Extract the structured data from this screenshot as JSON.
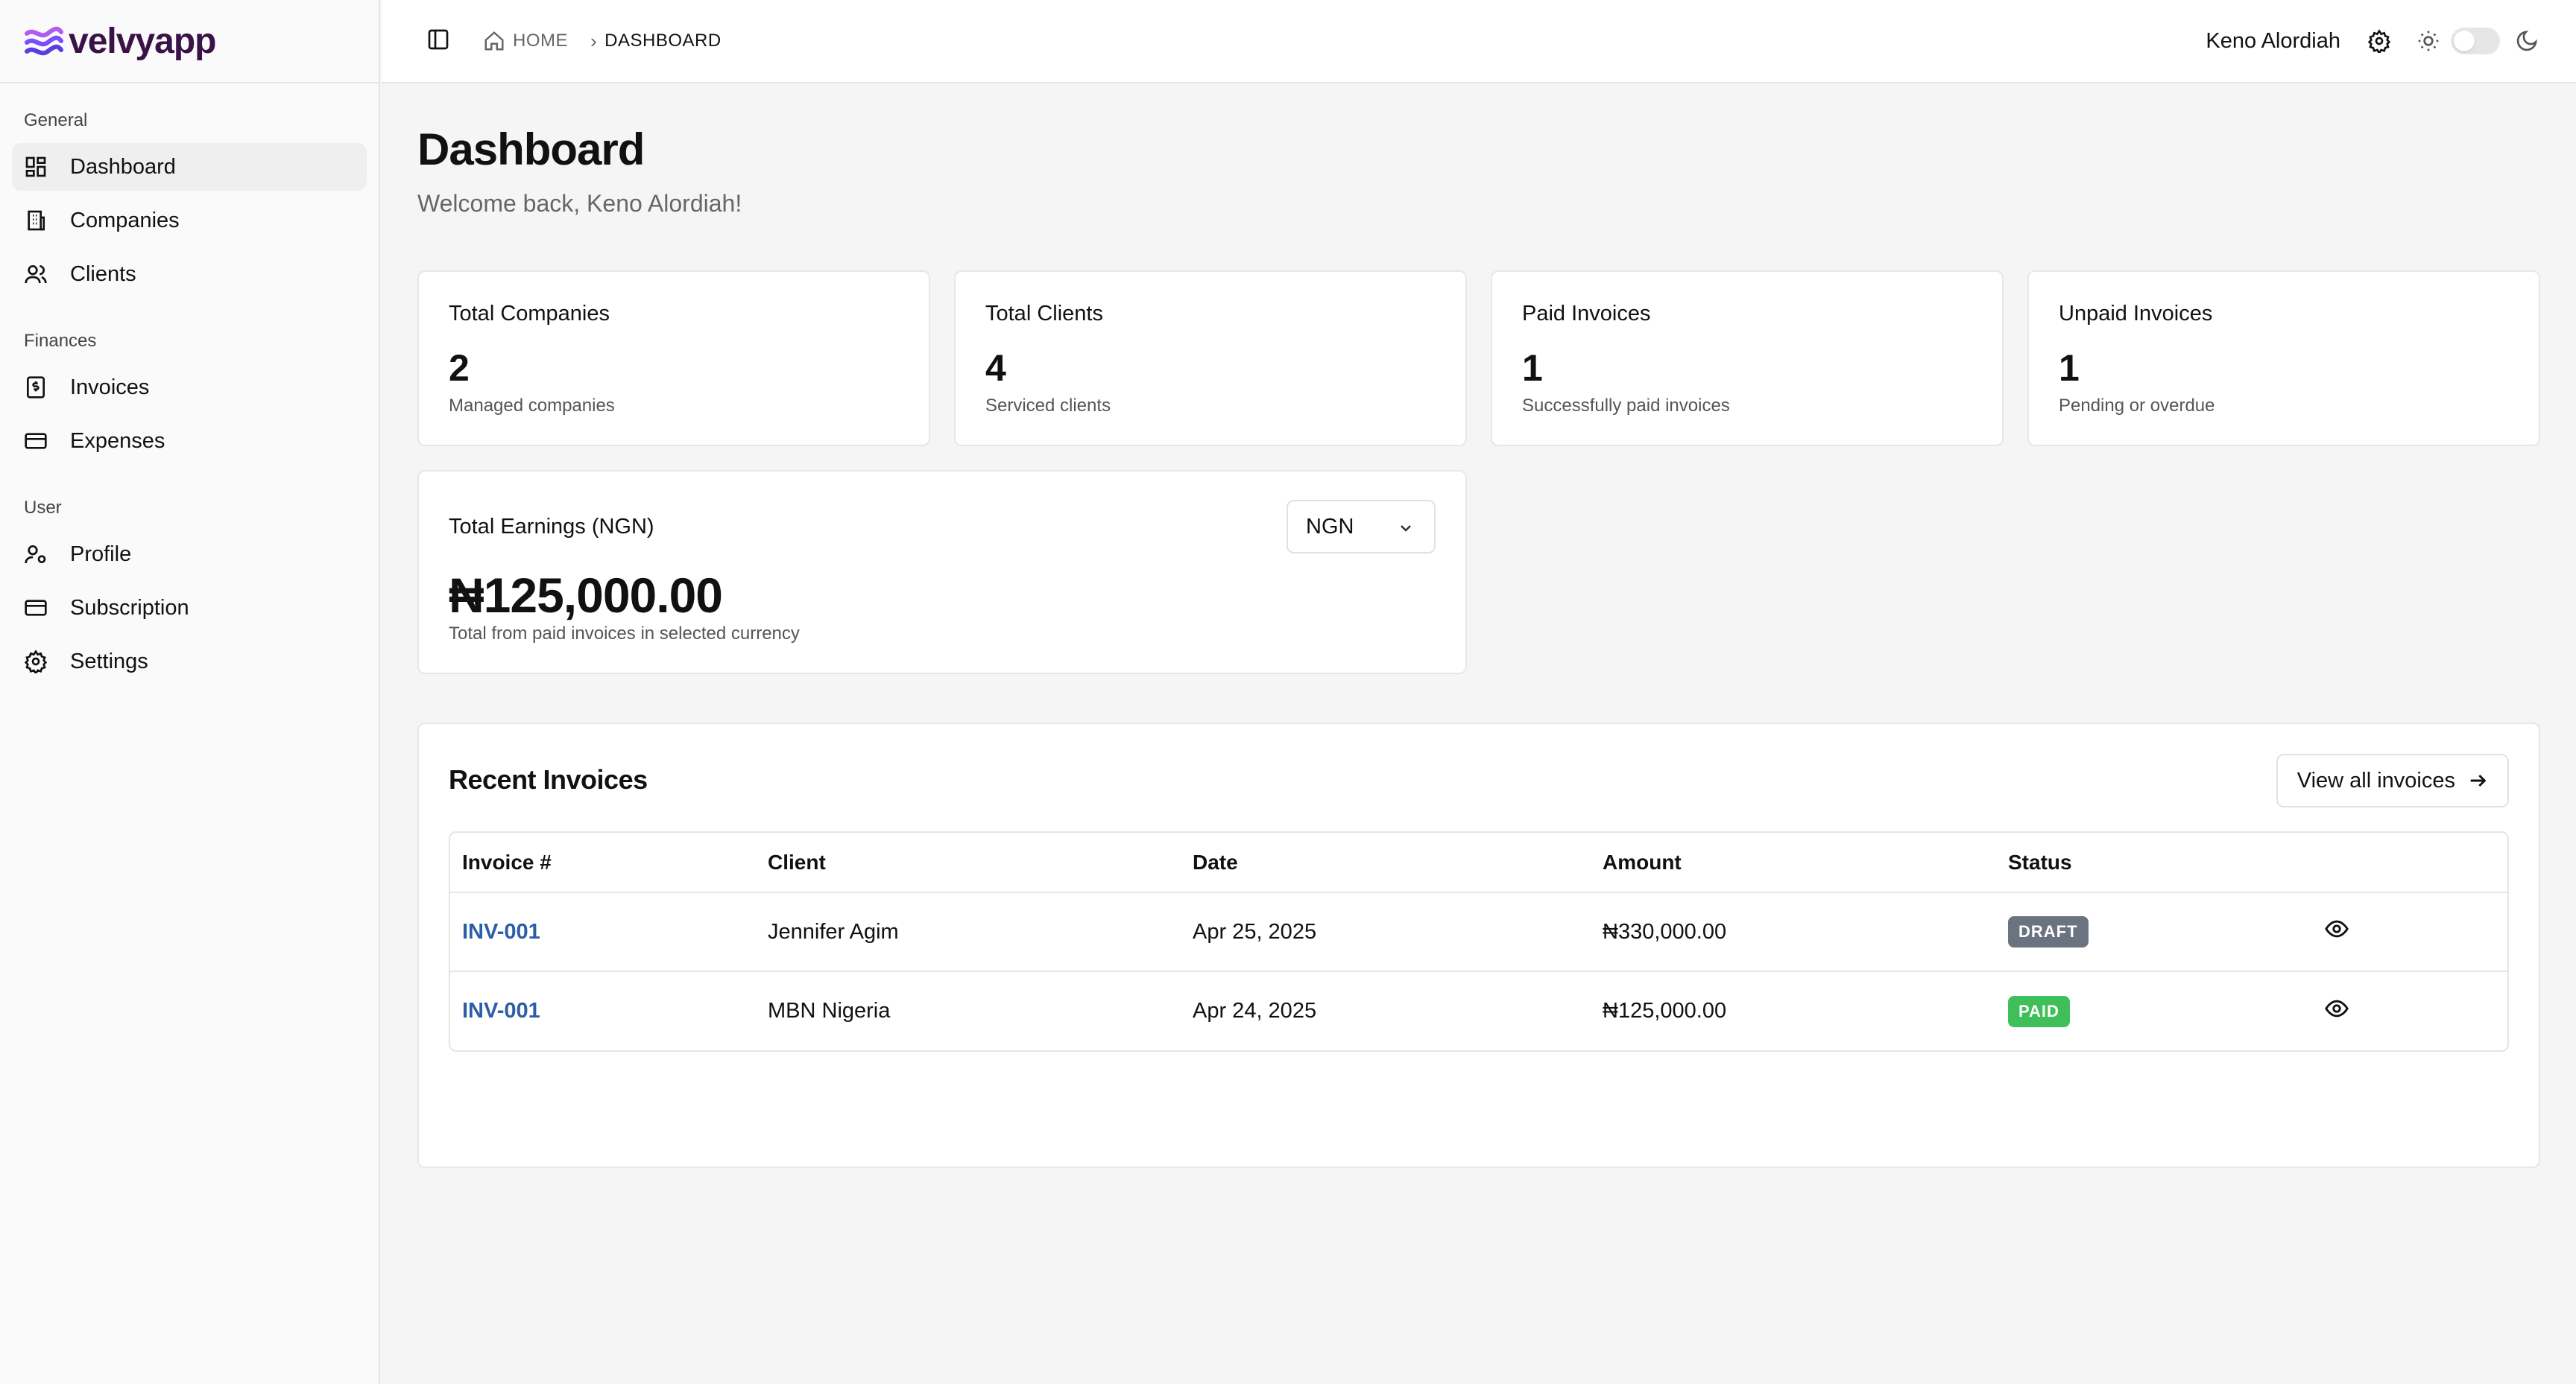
{
  "brand": {
    "name": "velvyapp",
    "logo_color": "#7c4dff"
  },
  "sidebar": {
    "groups": [
      {
        "heading": "General",
        "items": [
          {
            "label": "Dashboard",
            "icon": "dashboard-grid-icon",
            "active": true
          },
          {
            "label": "Companies",
            "icon": "building-icon"
          },
          {
            "label": "Clients",
            "icon": "users-icon"
          }
        ]
      },
      {
        "heading": "Finances",
        "items": [
          {
            "label": "Invoices",
            "icon": "receipt-icon"
          },
          {
            "label": "Expenses",
            "icon": "credit-card-icon"
          }
        ]
      },
      {
        "heading": "User",
        "items": [
          {
            "label": "Profile",
            "icon": "user-cog-icon"
          },
          {
            "label": "Subscription",
            "icon": "credit-card-icon"
          },
          {
            "label": "Settings",
            "icon": "gear-icon"
          }
        ]
      }
    ]
  },
  "topbar": {
    "breadcrumb": {
      "home": "HOME",
      "current": "DASHBOARD"
    },
    "user_name": "Keno Alordiah",
    "dark_mode": false
  },
  "page": {
    "title": "Dashboard",
    "welcome": "Welcome back, Keno Alordiah!"
  },
  "stats": [
    {
      "title": "Total Companies",
      "value": "2",
      "desc": "Managed companies"
    },
    {
      "title": "Total Clients",
      "value": "4",
      "desc": "Serviced clients"
    },
    {
      "title": "Paid Invoices",
      "value": "1",
      "desc": "Successfully paid invoices"
    },
    {
      "title": "Unpaid Invoices",
      "value": "1",
      "desc": "Pending or overdue"
    }
  ],
  "earnings": {
    "title": "Total Earnings (NGN)",
    "currency": "NGN",
    "value": "₦125,000.00",
    "desc": "Total from paid invoices in selected currency"
  },
  "recent_invoices": {
    "title": "Recent Invoices",
    "view_all_label": "View all invoices",
    "columns": [
      "Invoice #",
      "Client",
      "Date",
      "Amount",
      "Status"
    ],
    "rows": [
      {
        "invoice": "INV-001",
        "client": "Jennifer Agim",
        "date": "Apr 25, 2025",
        "amount": "₦330,000.00",
        "status": "DRAFT",
        "status_color": "#6b7280"
      },
      {
        "invoice": "INV-001",
        "client": "MBN Nigeria",
        "date": "Apr 24, 2025",
        "amount": "₦125,000.00",
        "status": "PAID",
        "status_color": "#3fbf5a"
      }
    ]
  }
}
